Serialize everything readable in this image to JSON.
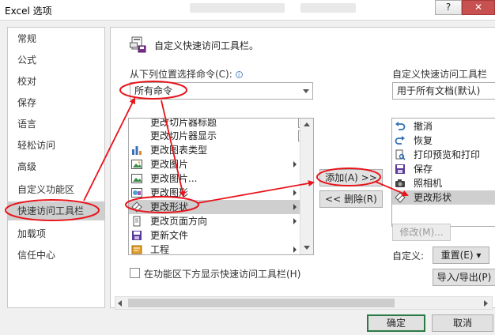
{
  "window": {
    "title": "Excel 选项",
    "help_label": "?",
    "close_label": "✕"
  },
  "sidebar": {
    "items": [
      {
        "label": "常规"
      },
      {
        "label": "公式"
      },
      {
        "label": "校对"
      },
      {
        "label": "保存"
      },
      {
        "label": "语言"
      },
      {
        "label": "轻松访问"
      },
      {
        "label": "高级"
      },
      {
        "label": "自定义功能区"
      },
      {
        "label": "快速访问工具栏"
      },
      {
        "label": "加载项"
      },
      {
        "label": "信任中心"
      }
    ],
    "selected": "快速访问工具栏"
  },
  "main": {
    "heading": "自定义快速访问工具栏。",
    "choose_label": "从下列位置选择命令(C):",
    "choose_value": "所有命令",
    "customize_label": "自定义快速访问工具栏",
    "customize_value": "用于所有文档(默认)",
    "commands": [
      {
        "label": "更改切片器标题",
        "icon": "slicer-icon"
      },
      {
        "label": "更改切片器显示",
        "icon": "slicer-icon"
      },
      {
        "label": "更改图表类型",
        "icon": "chart-type-icon"
      },
      {
        "label": "更改图片",
        "icon": "picture-icon"
      },
      {
        "label": "更改图片...",
        "icon": "picture-icon"
      },
      {
        "label": "更改图形",
        "icon": "graphic-icon"
      },
      {
        "label": "更改形状",
        "icon": "shape-icon"
      },
      {
        "label": "更改页面方向",
        "icon": "page-orientation-icon"
      },
      {
        "label": "更新文件",
        "icon": "update-file-icon"
      },
      {
        "label": "工程",
        "icon": "project-icon"
      }
    ],
    "selected_command": "更改形状",
    "add_button": "添加(A) >>",
    "remove_button": "<< 删除(R)",
    "toolbar_items": [
      {
        "label": "撤消",
        "icon": "undo-icon"
      },
      {
        "label": "恢复",
        "icon": "redo-icon"
      },
      {
        "label": "打印预览和打印",
        "icon": "print-preview-icon"
      },
      {
        "label": "保存",
        "icon": "save-icon"
      },
      {
        "label": "照相机",
        "icon": "camera-icon"
      },
      {
        "label": "更改形状",
        "icon": "shape-icon"
      }
    ],
    "selected_toolbar_item": "更改形状",
    "modify_button": "修改(M)...",
    "customizations_label": "自定义:",
    "reset_button": "重置(E) ▾",
    "import_export_button": "导入/导出(P)",
    "show_below_ribbon_label": "在功能区下方显示快速访问工具栏(H)"
  },
  "footer": {
    "ok_button": "确定",
    "cancel_button": "取消"
  },
  "colors": {
    "annotation": "#e8141b",
    "ok_border": "#2b7a45",
    "selection": "#cfcfcf",
    "accent_blue": "#2f6fb5"
  }
}
